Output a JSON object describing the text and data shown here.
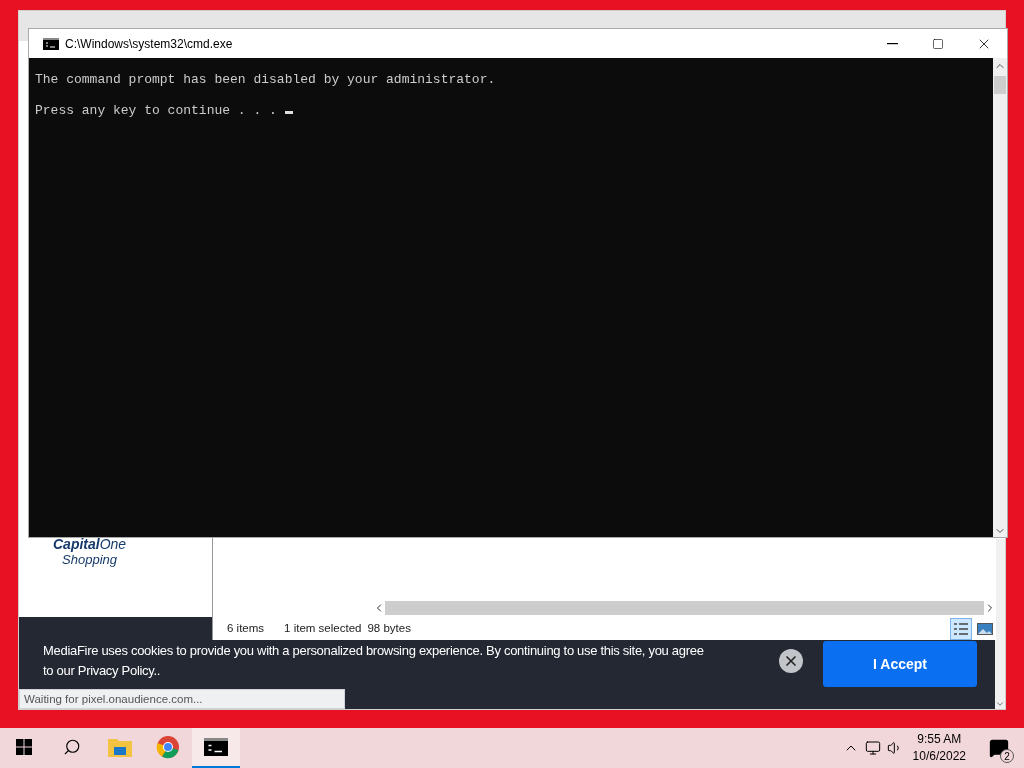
{
  "browser": {
    "logo": {
      "brand": "**Capital**One",
      "subtitle": "Shopping"
    },
    "cookie_banner": {
      "text": "MediaFire uses cookies to provide you with a personalized browsing experience. By continuing to use this site, you agree to our Privacy Policy..",
      "button": "I Accept"
    },
    "status": "Waiting for pixel.onaudience.com..."
  },
  "explorer": {
    "status": [
      "6 items",
      "1 item selected",
      "98 bytes"
    ],
    "views": [
      {
        "kind": "details",
        "selected": true
      },
      {
        "kind": "preview",
        "selected": false
      }
    ]
  },
  "console": {
    "title": "C:\\Windows\\system32\\cmd.exe",
    "lines": [
      "The command prompt has been disabled by your administrator.",
      "Press any key to continue . . ."
    ]
  },
  "taskbar": {
    "apps": [
      {
        "kind": "explorer",
        "active": false
      },
      {
        "kind": "chrome",
        "active": false
      },
      {
        "kind": "cmd",
        "active": true
      }
    ],
    "clock": {
      "time": "9:55 AM",
      "date": "10/6/2022"
    },
    "notifications": "2"
  }
}
